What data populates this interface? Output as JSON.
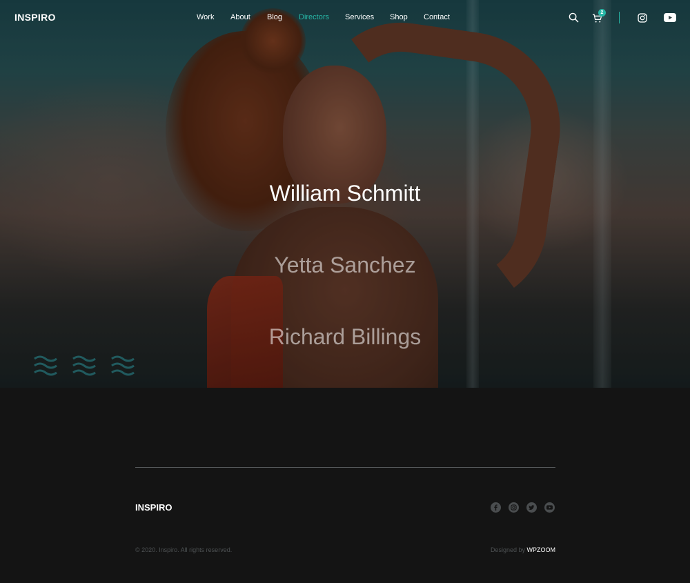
{
  "header": {
    "logo": "INSPIRO",
    "menu": [
      {
        "label": "Work",
        "active": false
      },
      {
        "label": "About",
        "active": false
      },
      {
        "label": "Blog",
        "active": false
      },
      {
        "label": "Directors",
        "active": true
      },
      {
        "label": "Services",
        "active": false
      },
      {
        "label": "Shop",
        "active": false
      },
      {
        "label": "Contact",
        "active": false
      }
    ],
    "cart_count": "2",
    "icons": [
      "search-icon",
      "cart-icon",
      "instagram-icon",
      "youtube-icon"
    ],
    "accent_color": "#27b7a7"
  },
  "hero": {
    "directors": [
      "William Schmitt",
      "Yetta Sanchez",
      "Richard Billings"
    ],
    "active_index": 0
  },
  "footer": {
    "logo": "INSPIRO",
    "social_icons": [
      "facebook-icon",
      "instagram-icon",
      "twitter-icon",
      "youtube-icon"
    ],
    "copyright": "© 2020. Inspiro. All rights reserved.",
    "designed_prefix": "Designed by",
    "designed_brand": "WPZOOM"
  }
}
